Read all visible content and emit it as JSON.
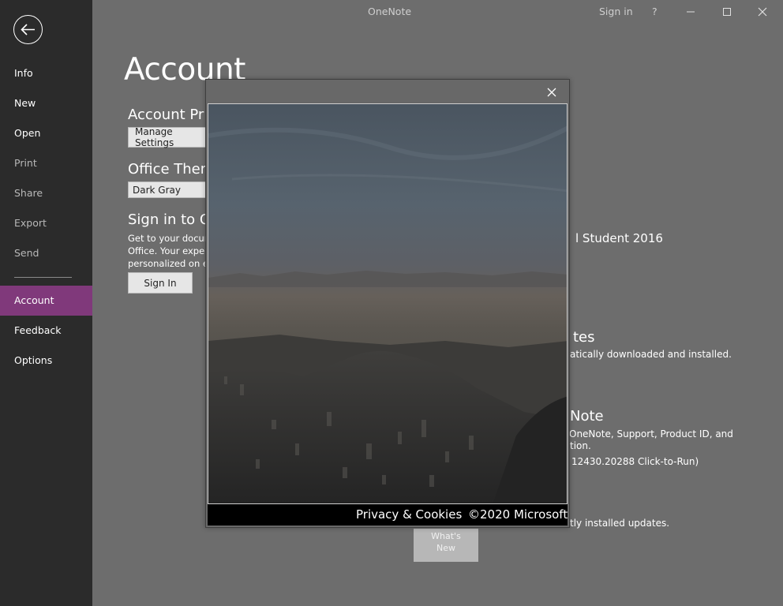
{
  "app": {
    "title": "OneNote",
    "sign_in": "Sign in",
    "help": "?"
  },
  "sidebar": {
    "items": [
      {
        "label": "Info"
      },
      {
        "label": "New"
      },
      {
        "label": "Open"
      },
      {
        "label": "Print"
      },
      {
        "label": "Share"
      },
      {
        "label": "Export"
      },
      {
        "label": "Send"
      },
      {
        "label": "Account"
      },
      {
        "label": "Feedback"
      },
      {
        "label": "Options"
      }
    ],
    "active_color": "#80397b"
  },
  "page": {
    "title": "Account",
    "privacy_head": "Account Priv",
    "manage_settings": "Manage Settings",
    "theme_head": "Office Them",
    "theme_value": "Dark Gray",
    "signin_head": "Sign in to Of",
    "signin_line1": "Get to your docum",
    "signin_line2": "Office.  Your exper",
    "signin_line3": "personalized on ev",
    "signin_button": "Sign In",
    "product_name": "l Student 2016",
    "updates_head": "tes",
    "updates_text": "atically downloaded and installed.",
    "about_head": "Note",
    "about_line1": "OneNote, Support, Product ID, and",
    "about_line2": "tion.",
    "about_version": "12430.20288 Click-to-Run)",
    "whatsnew_text": "tly installed updates.",
    "whatsnew_button_line1": "What's",
    "whatsnew_button_line2": "New"
  },
  "dialog": {
    "privacy_link": "Privacy & Cookies",
    "copyright": "©2020 Microsoft"
  }
}
